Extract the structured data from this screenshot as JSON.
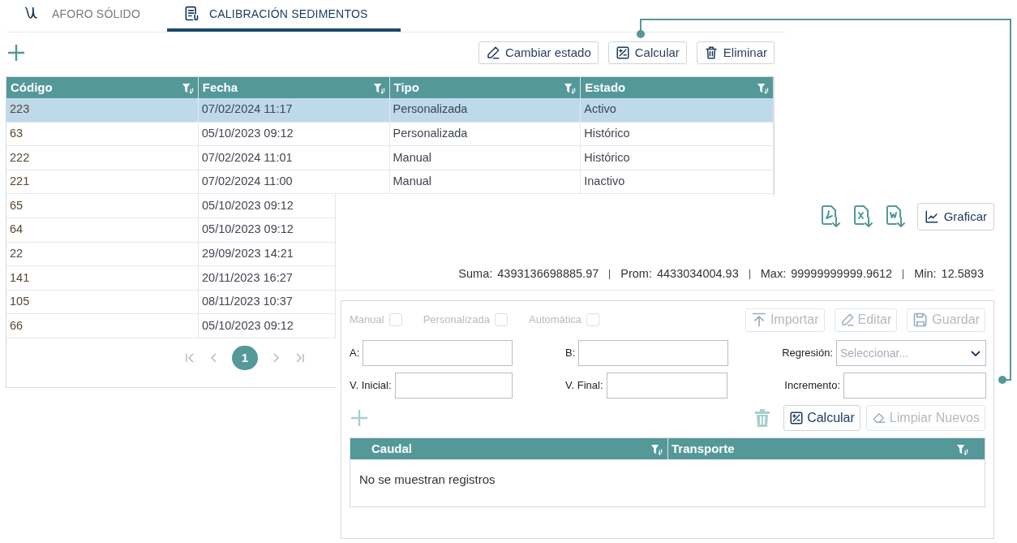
{
  "tabs": [
    {
      "label": "AFORO SÓLIDO",
      "kind": "curve",
      "selected": false
    },
    {
      "label": "CALIBRACIÓN SEDIMENTOS",
      "kind": "document",
      "selected": true
    }
  ],
  "toolbar": {
    "buttons": [
      {
        "label": "Cambiar estado",
        "kind": "edit"
      },
      {
        "label": "Calcular",
        "kind": "calc"
      },
      {
        "label": "Eliminar",
        "kind": "trash"
      }
    ]
  },
  "table": {
    "columns": [
      "Código",
      "Fecha",
      "Tipo",
      "Estado"
    ],
    "rows": [
      {
        "cells": [
          "223",
          "07/02/2024 11:17",
          "Personalizada",
          "Activo"
        ],
        "selected": true
      },
      {
        "cells": [
          "63",
          "05/10/2023 09:12",
          "Personalizada",
          "Histórico"
        ],
        "selected": false
      },
      {
        "cells": [
          "222",
          "07/02/2024 11:01",
          "Manual",
          "Histórico"
        ],
        "selected": false
      },
      {
        "cells": [
          "221",
          "07/02/2024 11:00",
          "Manual",
          "Inactivo"
        ],
        "selected": false
      },
      {
        "cells": [
          "65",
          "05/10/2023 09:12"
        ],
        "selected": false
      },
      {
        "cells": [
          "64",
          "05/10/2023 09:12"
        ],
        "selected": false
      },
      {
        "cells": [
          "22",
          "29/09/2023 14:21"
        ],
        "selected": false
      },
      {
        "cells": [
          "141",
          "20/11/2023 16:27"
        ],
        "selected": false
      },
      {
        "cells": [
          "105",
          "08/11/2023 10:37"
        ],
        "selected": false
      },
      {
        "cells": [
          "66",
          "05/10/2023 09:12"
        ],
        "selected": false
      }
    ],
    "pages": [
      {
        "label": "1",
        "selected": true
      }
    ]
  },
  "panel": {
    "exports": [
      {
        "kind": "pdf"
      },
      {
        "kind": "excel"
      },
      {
        "kind": "word"
      }
    ],
    "chart_button": "Graficar",
    "stats": [
      {
        "label": "Suma:",
        "value": "4393136698885.97"
      },
      {
        "label": "Prom:",
        "value": "4433034004.93"
      },
      {
        "label": "Max:",
        "value": "99999999999.9612"
      },
      {
        "label": "Min:",
        "value": "12.5893"
      }
    ],
    "modes": [
      {
        "label": "Manual",
        "checked": false,
        "disabled": true
      },
      {
        "label": "Personalizada",
        "checked": false,
        "disabled": true
      },
      {
        "label": "Automática",
        "checked": false,
        "disabled": true
      }
    ],
    "actions": [
      {
        "label": "Importar",
        "kind": "upload",
        "disabled": true
      },
      {
        "label": "Editar",
        "kind": "edit",
        "disabled": true
      },
      {
        "label": "Guardar",
        "kind": "save",
        "disabled": true
      }
    ],
    "fields": [
      {
        "label": "A:"
      },
      {
        "label": "B:"
      },
      {
        "label": "Regresión:",
        "kind": "select",
        "placeholder": "Seleccionar..."
      },
      {
        "label": "V. Inicial:"
      },
      {
        "label": "V. Final:"
      },
      {
        "label": "Incremento:"
      }
    ],
    "add_disabled": true,
    "delete_disabled": true,
    "buttons": [
      {
        "label": "Calcular",
        "kind": "calc",
        "disabled": false
      },
      {
        "label": "Limpiar Nuevos",
        "kind": "eraser",
        "disabled": true
      }
    ],
    "table": {
      "columns": [
        "Caudal",
        "Transporte"
      ],
      "empty_message": "No se muestran registros"
    }
  }
}
